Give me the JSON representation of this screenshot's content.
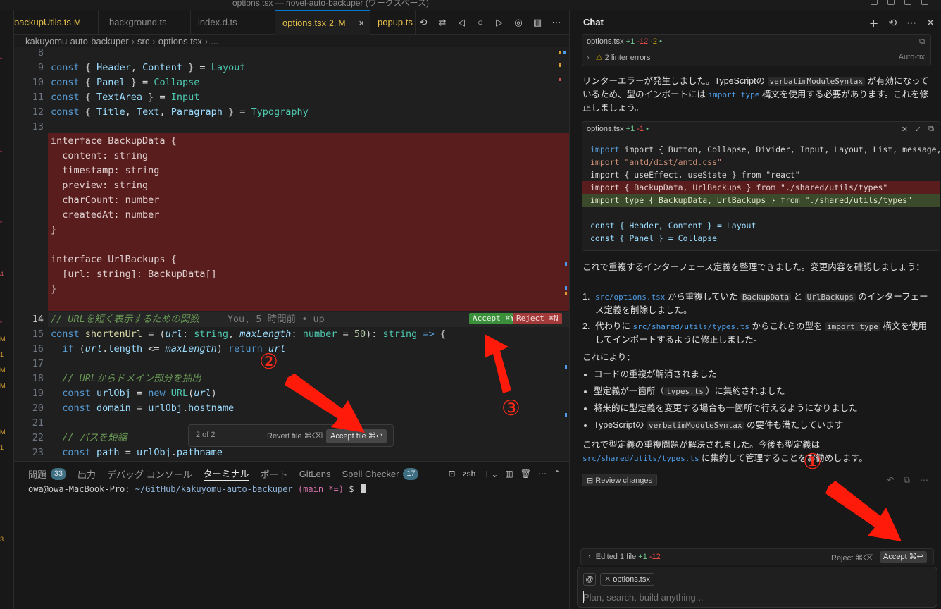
{
  "window": {
    "title": "options.tsx — novel-auto-backuper (ワークスペース)"
  },
  "tabs": [
    {
      "name": "backupUtils.ts",
      "status": "M"
    },
    {
      "name": "background.ts",
      "status": ""
    },
    {
      "name": "index.d.ts",
      "status": ""
    },
    {
      "name": "options.tsx",
      "status": "2, M",
      "close": "×"
    },
    {
      "name": "popup.ts",
      "status": ""
    }
  ],
  "breadcrumb": {
    "parts": [
      "kakuyomu-auto-backuper",
      "src",
      "options.tsx",
      "..."
    ]
  },
  "editor": {
    "line_numbers": [
      "8",
      "9",
      "10",
      "11",
      "12",
      "13",
      "14",
      "15",
      "16",
      "17",
      "18",
      "19",
      "20",
      "21",
      "22",
      "23"
    ],
    "blame": "You, 5 時間前 • up",
    "accept_inline": "Accept ⌘Y",
    "reject_inline": "Reject ⌘N",
    "deleted_lines": [
      "interface BackupData {",
      "  content: string",
      "  timestamp: string",
      "  preview: string",
      "  charCount: number",
      "  createdAt: number",
      "}",
      "",
      "interface UrlBackups {",
      "  [url: string]: BackupData[]",
      "}"
    ],
    "comment_14": "// URLを短く表示するための関数",
    "comment_18": "// URLからドメイン部分を抽出",
    "comment_22": "// パスを短縮"
  },
  "review_bar": {
    "count": "2 of 2",
    "revert": "Revert file ⌘⌫",
    "accept": "Accept file ⌘↩"
  },
  "panel": {
    "tabs": [
      {
        "label": "問題",
        "badge": "33"
      },
      {
        "label": "出力"
      },
      {
        "label": "デバッグ コンソール"
      },
      {
        "label": "ターミナル",
        "active": true
      },
      {
        "label": "ポート"
      },
      {
        "label": "GitLens"
      },
      {
        "label": "Spell Checker",
        "badge": "17"
      }
    ],
    "shell": "zsh",
    "prompt_user": "owa@owa-MacBook-Pro",
    "prompt_path": "~/GitHub/kakuyomu-auto-backuper",
    "prompt_branch": "(main *=)",
    "prompt_symbol": "$"
  },
  "chat": {
    "tab": "Chat",
    "card1": {
      "file": "options.tsx",
      "add": "+1",
      "del": "-12",
      "warn": "·2",
      "lint": "2 linter errors",
      "autofix": "Auto-fix"
    },
    "msg1": {
      "a": "リンターエラーが発生しました。TypeScriptの ",
      "code1": "verbatimModuleSyntax",
      "b": " が有効になっているため、型のインポートには ",
      "code2": "import type",
      "c": " 構文を使用する必要があります。これを修正しましょう。"
    },
    "card2": {
      "file": "options.tsx",
      "add": "+1",
      "del": "-1",
      "lines": [
        "import { Button, Collapse, Divider, Input, Layout, List, message, Modal, Popconfi",
        "import \"antd/dist/antd.css\"",
        "import { useEffect, useState } from \"react\"",
        "import { BackupData, UrlBackups } from \"./shared/utils/types\"",
        "import type { BackupData, UrlBackups } from \"./shared/utils/types\"",
        "",
        "const { Header, Content } = Layout",
        "const { Panel } = Collapse"
      ]
    },
    "msg2": "これで重複するインターフェース定義を整理できました。変更内容を確認しましょう：",
    "ol": [
      {
        "n": "1.",
        "path": "src/options.tsx",
        "a": " から重複していた ",
        "c1": "BackupData",
        "b": " と ",
        "c2": "UrlBackups",
        "c": " のインターフェース定義を削除しました。"
      },
      {
        "n": "2.",
        "a": "代わりに ",
        "path": "src/shared/utils/types.ts",
        "b": " からこれらの型を ",
        "c1": "import type",
        "c": " 構文を使用してインポートするように修正しました。"
      }
    ],
    "msg3": "これにより：",
    "ul": [
      "コードの重複が解消されました",
      "型定義が一箇所（",
      "将来的に型定義を変更する場合も一箇所で行えるようになりました",
      "TypeScriptの "
    ],
    "ul_extra": {
      "types_file": "types.ts",
      "after2": "）に集約されました",
      "code4": "verbatimModuleSyntax",
      "after4": " の要件も満たしています"
    },
    "msg4": {
      "a": "これで型定義の重複問題が解決されました。今後も型定義は ",
      "path": "src/shared/utils/types.ts",
      "b": " に集約して管理することをお勧めします。"
    },
    "review_changes": "Review changes",
    "edited": {
      "label": "Edited 1 file",
      "add": "+1",
      "del": "-12",
      "reject": "Reject ⌘⌫",
      "accept": "Accept ⌘↩"
    },
    "composer": {
      "mention": "@",
      "file_chip": "options.tsx",
      "placeholder": "Plan, search, build anything..."
    }
  },
  "annotations": {
    "one": "①",
    "two": "②",
    "three": "③"
  }
}
